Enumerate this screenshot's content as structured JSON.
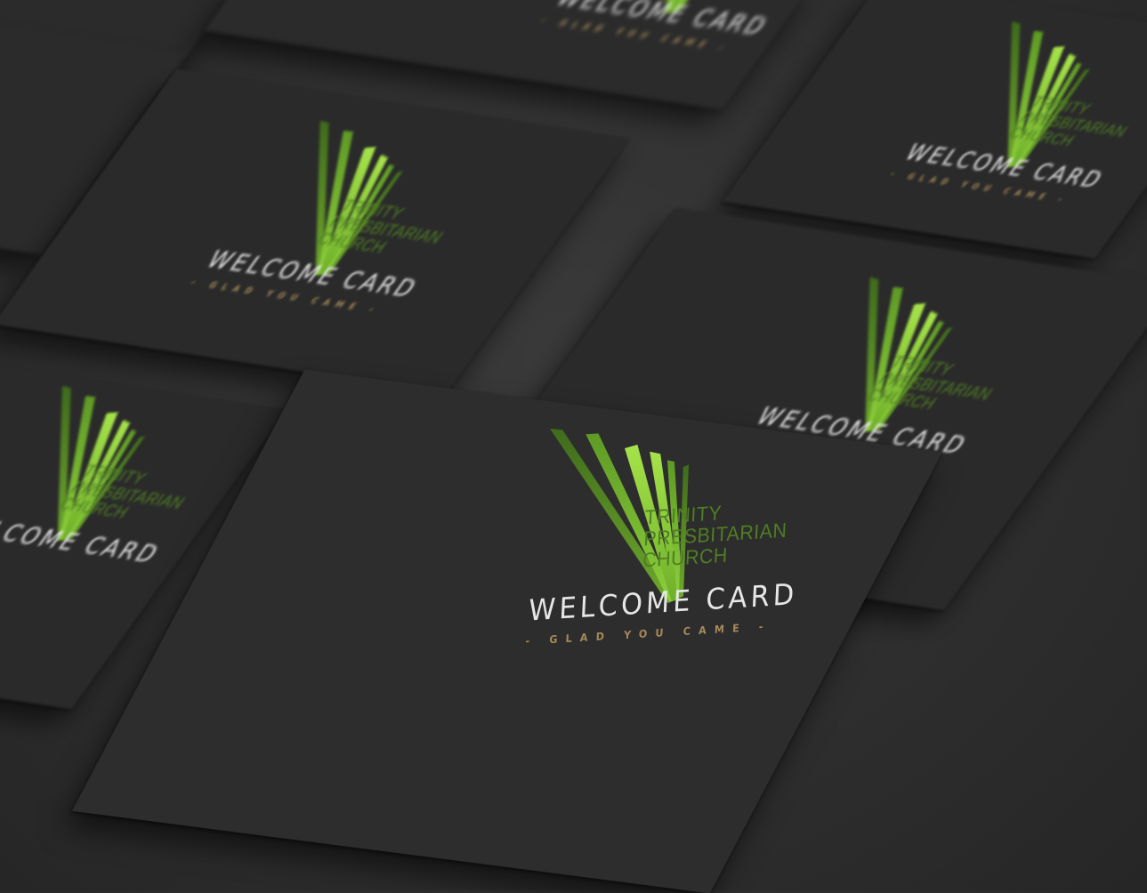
{
  "scene": {
    "description_colors": {
      "background": "#2c2c2c",
      "card": "#2b2b2b",
      "brand_green": "#4f7d24",
      "lime": "#8fd63c",
      "gold": "#a58a5a",
      "white": "#e6e6e6"
    }
  },
  "brand": {
    "church_line1": "TRINITY",
    "church_line2": "PRESBITARIAN",
    "church_line3": "CHURCH",
    "title": "WELCOME CARD",
    "tagline": "- GLAD YOU CAME -",
    "logo_icon": "grass-blades-icon"
  }
}
